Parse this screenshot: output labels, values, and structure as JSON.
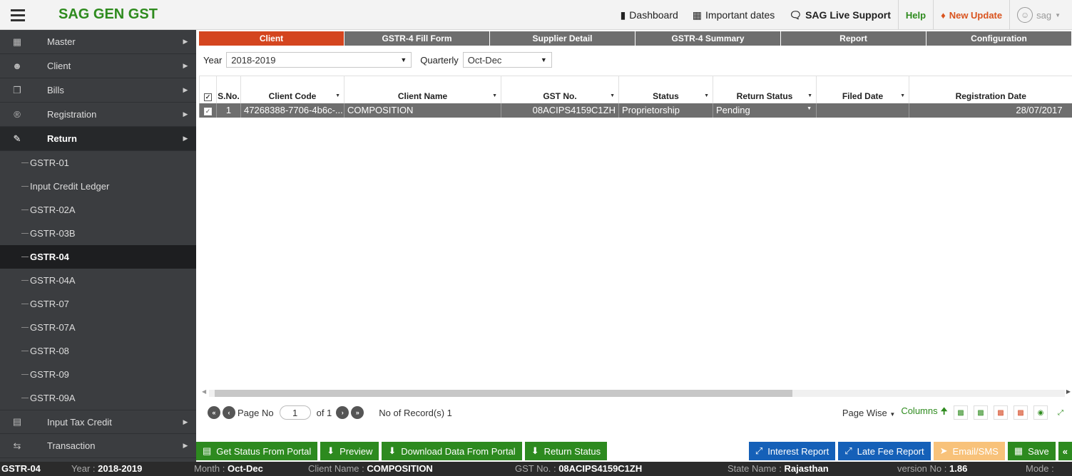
{
  "app": {
    "title": "SAG GEN GST"
  },
  "topnav": {
    "dashboard": "Dashboard",
    "important_dates": "Important dates",
    "live_support": "SAG Live Support",
    "help": "Help",
    "new_update": "New Update",
    "user": "sag"
  },
  "sidebar": {
    "items": [
      {
        "label": "Master"
      },
      {
        "label": "Client"
      },
      {
        "label": "Bills"
      },
      {
        "label": "Registration"
      },
      {
        "label": "Return"
      }
    ],
    "return_sub": [
      {
        "label": "GSTR-01"
      },
      {
        "label": "Input Credit Ledger"
      },
      {
        "label": "GSTR-02A"
      },
      {
        "label": "GSTR-03B"
      },
      {
        "label": "GSTR-04"
      },
      {
        "label": "GSTR-04A"
      },
      {
        "label": "GSTR-07"
      },
      {
        "label": "GSTR-07A"
      },
      {
        "label": "GSTR-08"
      },
      {
        "label": "GSTR-09"
      },
      {
        "label": "GSTR-09A"
      }
    ],
    "bottom": [
      {
        "label": "Input Tax Credit"
      },
      {
        "label": "Transaction"
      }
    ]
  },
  "tabs": [
    {
      "label": "Client"
    },
    {
      "label": "GSTR-4 Fill Form"
    },
    {
      "label": "Supplier Detail"
    },
    {
      "label": "GSTR-4 Summary"
    },
    {
      "label": "Report"
    },
    {
      "label": "Configuration"
    }
  ],
  "filters": {
    "year_label": "Year",
    "year_value": "2018-2019",
    "quarterly_label": "Quarterly",
    "quarterly_value": "Oct-Dec"
  },
  "table": {
    "headers": {
      "sno": "S.No.",
      "client_code": "Client Code",
      "client_name": "Client Name",
      "gst_no": "GST No.",
      "status": "Status",
      "return_status": "Return Status",
      "filed_date": "Filed Date",
      "registration_date": "Registration Date"
    },
    "row": {
      "sno": "1",
      "client_code": "47268388-7706-4b6c-...",
      "client_name": "COMPOSITION",
      "gst_no": "08ACIPS4159C1ZH",
      "status": "Proprietorship",
      "return_status": "Pending",
      "filed_date": "",
      "registration_date": "28/07/2017"
    }
  },
  "pager": {
    "page_no_label": "Page No",
    "page_value": "1",
    "of_label": "of 1",
    "records": "No of Record(s) 1",
    "page_wise": "Page Wise",
    "columns": "Columns"
  },
  "actions": {
    "get_status": "Get Status From Portal",
    "preview": "Preview",
    "download": "Download Data From Portal",
    "return_status": "Return Status",
    "interest_report": "Interest Report",
    "late_fee_report": "Late Fee Report",
    "email_sms": "Email/SMS",
    "save": "Save"
  },
  "statusbar": {
    "form": "GSTR-04",
    "year_label": "Year :",
    "year_value": "2018-2019",
    "month_label": "Month :",
    "month_value": "Oct-Dec",
    "client_label": "Client Name :",
    "client_value": "COMPOSITION",
    "gst_label": "GST No. :",
    "gst_value": "08ACIPS4159C1ZH",
    "state_label": "State Name :",
    "state_value": "Rajasthan",
    "version_label": "version No :",
    "version_value": "1.86",
    "mode_label": "Mode :"
  },
  "colors": {
    "brand_green": "#2e8b1e",
    "tab_active": "#d4451f",
    "tab_inactive": "#6e6e6e",
    "sidebar": "#3b3d40",
    "action_green": "#2d8a1f",
    "action_blue": "#1560b8",
    "action_orange": "#f8c27a"
  }
}
